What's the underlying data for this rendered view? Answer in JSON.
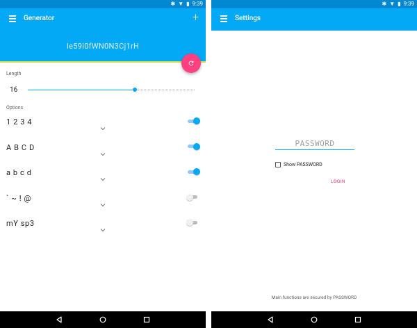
{
  "status_bar": {
    "time": "9:39"
  },
  "generator_screen": {
    "title": "Generator",
    "add_label": "+",
    "generated_password": "Ie59i0fWN0N3Cj1rH",
    "length_section_label": "Length",
    "length_value": "16",
    "length_slider_fraction": 0.64,
    "options_section_label": "Options",
    "options": [
      {
        "label": "1 2 3 4",
        "enabled": true
      },
      {
        "label": "A B C D",
        "enabled": true
      },
      {
        "label": "a b c d",
        "enabled": true
      },
      {
        "label": "` ~ ! @",
        "enabled": false
      },
      {
        "label": "mY sp3",
        "enabled": false
      }
    ]
  },
  "settings_screen": {
    "title": "Settings",
    "password_placeholder": "PASSWORD",
    "show_password_label": "Show PASSWORD",
    "login_label": "LOGIN",
    "footer_note": "Main functions are secured by PASSWORD"
  },
  "colors": {
    "primary": "#03a9f4",
    "primary_dark": "#0288d1",
    "accent": "#ff4081",
    "login_text": "#e91e63"
  },
  "icons": {
    "menu": "menu-icon",
    "refresh": "refresh-icon",
    "back": "back-icon",
    "home": "home-icon",
    "recents": "recents-icon"
  }
}
